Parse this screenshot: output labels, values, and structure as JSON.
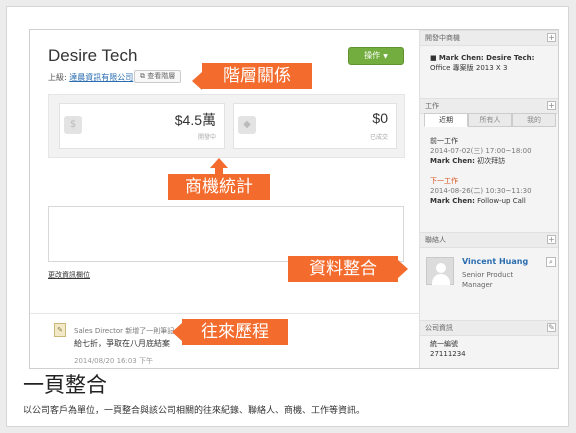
{
  "company": {
    "title": "Desire Tech",
    "parent_label": "上級:",
    "parent_link": "達晨資訊有限公司",
    "hierarchy_button": "查看階層",
    "action_button": "操作"
  },
  "stats": [
    {
      "value": "$4.5萬",
      "label": "開發中",
      "icon": "money-bag-icon"
    },
    {
      "value": "$0",
      "label": "已成交",
      "icon": "handshake-icon"
    }
  ],
  "notes_link": "更改資訊欄位",
  "feed": {
    "line1": "Sales Director 新增了一則筆記",
    "line2": "給七折，爭取在八月底結案",
    "time": "2014/08/20 16:03 下午"
  },
  "sidebar": {
    "opportunities_header": "開發中商機",
    "opportunity_owner": "Mark Chen: Desire Tech:",
    "opportunity_name": "Office 專案版 2013 X 3",
    "tasks_header": "工作",
    "tabs": [
      "近期",
      "所有人",
      "我的"
    ],
    "task1_label": "前一工作",
    "task1_when": "2014-07-02(三) 17:00~18:00",
    "task1_owner": "Mark Chen:",
    "task1_name": "初次拜訪",
    "task2_label": "下一工作",
    "task2_when": "2014-08-26(二) 10:30~11:30",
    "task2_owner": "Mark Chen:",
    "task2_name": "Follow-up Call",
    "contacts_header": "聯絡人",
    "contact_name": "Vincent Huang",
    "contact_title": "Senior Product Manager",
    "company_info_header": "公司資訊",
    "company_info_label": "統一編號",
    "company_info_value": "27111234"
  },
  "callouts": {
    "hierarchy": "階層關係",
    "stats": "商機統計",
    "integration": "資料整合",
    "history": "往來歷程"
  },
  "caption": {
    "title": "一頁整合",
    "body": "以公司客戶為單位，一頁整合與該公司相關的往來紀錄、聯絡人、商機、工作等資訊。"
  },
  "colors": {
    "accent": "#f36b2d",
    "action_button": "#74ad3f",
    "link": "#2a6db0"
  }
}
